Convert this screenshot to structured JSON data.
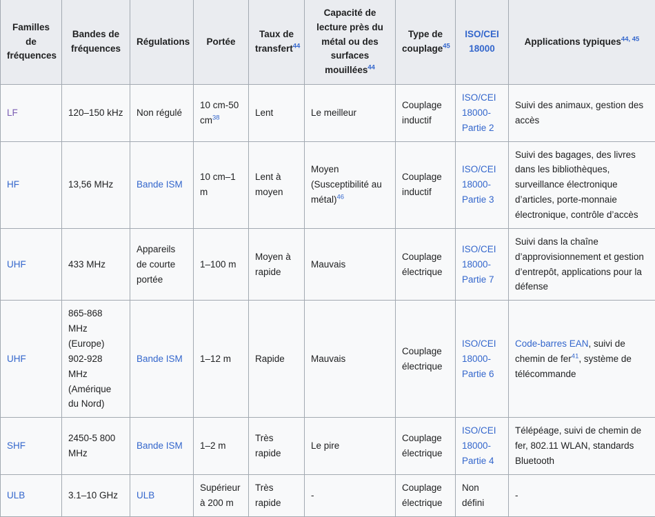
{
  "table": {
    "headers": [
      {
        "label": "Familles de fréquences",
        "sup": ""
      },
      {
        "label": "Bandes de fréquences",
        "sup": ""
      },
      {
        "label": "Régulations",
        "sup": ""
      },
      {
        "label": "Portée",
        "sup": ""
      },
      {
        "label": "Taux de transfert",
        "sup": "44"
      },
      {
        "label": "Capacité de lecture près du métal ou des surfaces mouillées",
        "sup": "44"
      },
      {
        "label": "Type de couplage",
        "sup": "45"
      },
      {
        "label": "ISO/CEI 18000",
        "sup": "",
        "link": true
      },
      {
        "label": "Applications typiques",
        "sup": "44, 45"
      }
    ],
    "rows": [
      {
        "family": "LF",
        "family_link": "visited",
        "band": "120–150 kHz",
        "regulation": "Non régulé",
        "regulation_link": false,
        "range": "10 cm-50 cm",
        "range_sup": "38",
        "rate": "Lent",
        "metal": "Le meilleur",
        "metal_sup": "",
        "coupling": "Couplage inductif",
        "iso": "ISO/CEI 18000-Partie 2",
        "applications": "Suivi des animaux, gestion des accès",
        "applications_link_part": "",
        "applications_sup": ""
      },
      {
        "family": "HF",
        "family_link": "normal",
        "band": "13,56 MHz",
        "regulation": "Bande ISM",
        "regulation_link": true,
        "range": "10 cm–1 m",
        "range_sup": "",
        "rate": "Lent à moyen",
        "metal": "Moyen (Susceptibilité au métal)",
        "metal_sup": "46",
        "coupling": "Couplage inductif",
        "iso": "ISO/CEI 18000-Partie 3",
        "applications": "Suivi des bagages, des livres dans les bibliothèques, surveillance électronique d’articles, porte-monnaie électronique, contrôle d’accès",
        "applications_link_part": "",
        "applications_sup": ""
      },
      {
        "family": "UHF",
        "family_link": "normal",
        "band": "433 MHz",
        "regulation": "Appareils de courte portée",
        "regulation_link": false,
        "range": "1–100 m",
        "range_sup": "",
        "rate": "Moyen à rapide",
        "metal": "Mauvais",
        "metal_sup": "",
        "coupling": "Couplage électrique",
        "iso": "ISO/CEI 18000-Partie 7",
        "applications": "Suivi dans la chaîne d’approvisionnement et gestion d’entrepôt, applications pour la défense",
        "applications_link_part": "",
        "applications_sup": ""
      },
      {
        "family": "UHF",
        "family_link": "normal",
        "band": "865-868 MHz (Europe) 902-928 MHz (Amérique du Nord)",
        "regulation": "Bande ISM",
        "regulation_link": true,
        "range": "1–12 m",
        "range_sup": "",
        "rate": "Rapide",
        "metal": "Mauvais",
        "metal_sup": "",
        "coupling": "Couplage électrique",
        "iso": "ISO/CEI 18000-Partie 6",
        "applications": ", suivi de chemin de fer",
        "applications_link_part": "Code-barres EAN",
        "applications_sup": "41",
        "applications_tail": ", système de télécommande"
      },
      {
        "family": "SHF",
        "family_link": "normal",
        "band": "2450-5 800 MHz",
        "regulation": "Bande ISM",
        "regulation_link": true,
        "range": "1–2 m",
        "range_sup": "",
        "rate": "Très rapide",
        "metal": "Le pire",
        "metal_sup": "",
        "coupling": "Couplage électrique",
        "iso": "ISO/CEI 18000-Partie 4",
        "applications": "Télépéage, suivi de chemin de fer, 802.11 WLAN, standards Bluetooth",
        "applications_link_part": "",
        "applications_sup": ""
      },
      {
        "family": "ULB",
        "family_link": "normal",
        "band": "3.1–10 GHz",
        "regulation": "ULB",
        "regulation_link": true,
        "range": "Supérieur à 200 m",
        "range_sup": "",
        "rate": "Très rapide",
        "metal": "-",
        "metal_sup": "",
        "coupling": "Couplage électrique",
        "iso": "Non défini",
        "iso_link": false,
        "applications": "-",
        "applications_link_part": "",
        "applications_sup": ""
      }
    ]
  },
  "colors": {
    "link": "#3366cc",
    "link_visited": "#795cb2",
    "header_bg": "#eaecf0",
    "cell_bg": "#f8f9fa",
    "border": "#a2a9b1",
    "text": "#202122"
  }
}
